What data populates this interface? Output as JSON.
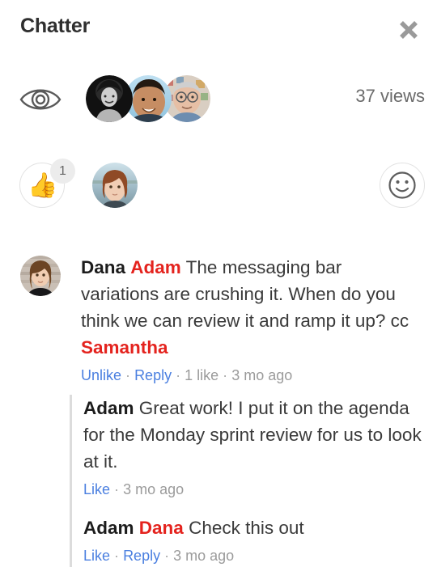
{
  "header": {
    "title": "Chatter",
    "close_icon": "close-icon"
  },
  "viewers": {
    "eye_icon": "eye-icon",
    "views_label": "37 views",
    "avatars": [
      {
        "name": "viewer-avatar-1",
        "alt": "curly-haired person black and white photo"
      },
      {
        "name": "viewer-avatar-2",
        "alt": "smiling man with blue sky background"
      },
      {
        "name": "viewer-avatar-3",
        "alt": "older man with glasses"
      }
    ]
  },
  "reactions": {
    "thumbs_up_emoji": "👍",
    "thumbs_up_count": "1",
    "reactor_avatar_alt": "woman with auburn hair by the lake",
    "add_reaction_icon": "smiley-face-icon"
  },
  "comments": {
    "root": {
      "avatar_alt": "Dana portrait",
      "author": "Dana",
      "mention": "Adam",
      "text": " The messaging bar variations are crushing it. When do you think we can review it and ramp it up? cc ",
      "mention_2": "Samantha",
      "meta": {
        "like_label": "Unlike",
        "reply_label": "Reply",
        "likes": "1 like",
        "time": "3 mo ago",
        "sep": "·"
      }
    },
    "replies": [
      {
        "author": "Adam",
        "mention": "",
        "text": " Great work! I put it on the agenda for the Monday sprint review for us to look at it.",
        "meta": {
          "like_label": "Like",
          "reply_label": "",
          "time": "3 mo ago",
          "sep": "·"
        }
      },
      {
        "author": "Adam",
        "mention": "Dana",
        "text": " Check this out",
        "meta": {
          "like_label": "Like",
          "reply_label": "Reply",
          "time": "3 mo ago",
          "sep": "·"
        }
      }
    ]
  },
  "colors": {
    "mention_red": "#e4231e",
    "link_blue": "#4a7fe0",
    "meta_gray": "#9b9b9b",
    "text_dark": "#3a3a3a",
    "border_gray": "#e2e2e2",
    "rail_gray": "#dcdcdc"
  }
}
